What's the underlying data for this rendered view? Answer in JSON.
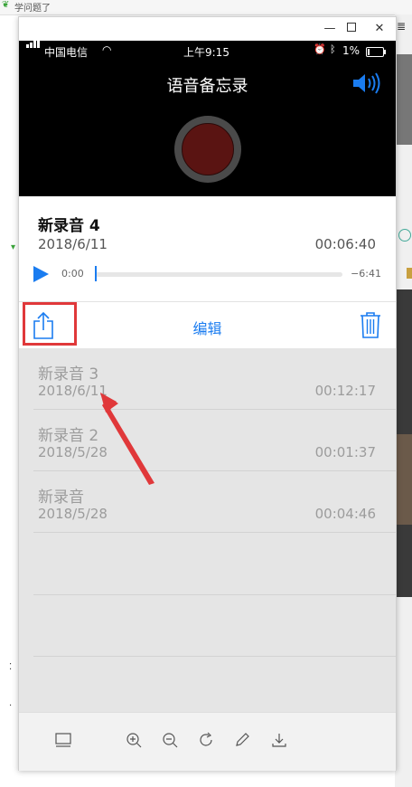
{
  "background": {
    "top_text": "学问题了"
  },
  "window": {
    "min_glyph": "—",
    "close_glyph": "✕"
  },
  "status_bar": {
    "carrier": "中国电信",
    "time": "上午9:15",
    "battery_pct": "1%"
  },
  "app": {
    "title": "语音备忘录",
    "current": {
      "name": "新录音 4",
      "date": "2018/6/11",
      "duration": "00:06:40",
      "elapsed": "0:00",
      "remaining": "−6:41",
      "progress": 0
    },
    "actions": {
      "edit_label": "编辑"
    },
    "recordings": [
      {
        "name": "新录音 3",
        "date": "2018/6/11",
        "duration": "00:12:17"
      },
      {
        "name": "新录音 2",
        "date": "2018/5/28",
        "duration": "00:01:37"
      },
      {
        "name": "新录音",
        "date": "2018/5/28",
        "duration": "00:04:46"
      }
    ]
  },
  "colors": {
    "accent": "#1a7cf0",
    "annotation": "#e0383a",
    "record": "#5a1412"
  },
  "toolbar_icons": [
    "thumbnail-icon",
    "zoom-in-icon",
    "zoom-out-icon",
    "rotate-icon",
    "edit-pen-icon",
    "download-icon"
  ]
}
